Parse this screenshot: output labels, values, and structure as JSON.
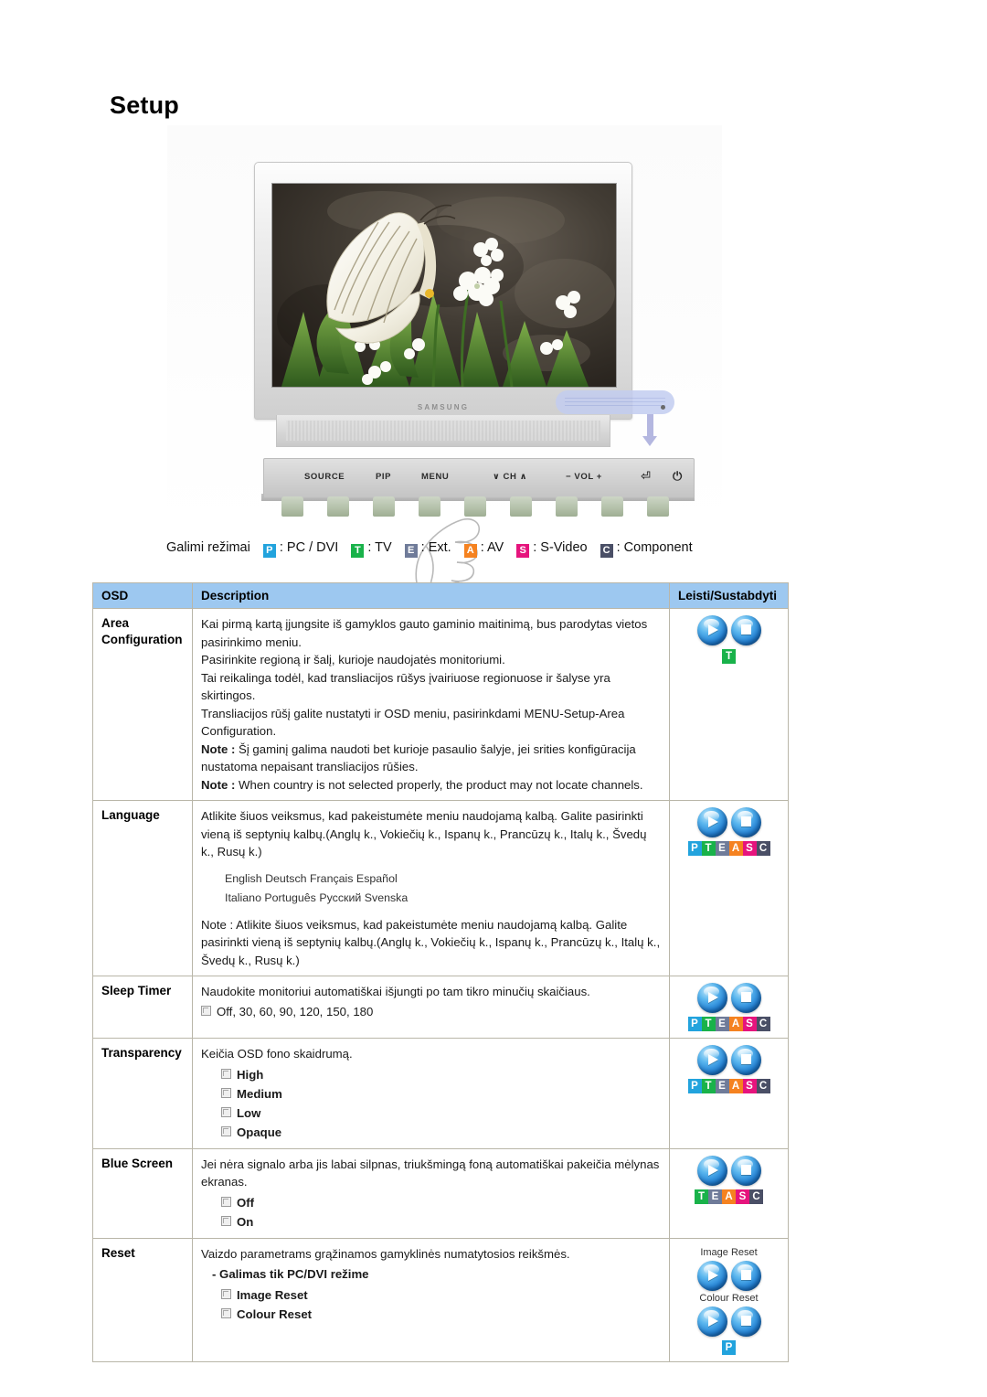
{
  "page": {
    "title": "Setup"
  },
  "illustration": {
    "brand": "SAMSUNG",
    "controls": [
      "SOURCE",
      "PIP",
      "MENU",
      "∨  CH  ∧",
      "−  VOL  +",
      "⏎",
      "⏻"
    ]
  },
  "modes": {
    "lead": "Galimi režimai",
    "items": [
      {
        "letter": "P",
        "label": ": PC / DVI",
        "color": "#22a3dd"
      },
      {
        "letter": "T",
        "label": ": TV",
        "color": "#19b24a"
      },
      {
        "letter": "E",
        "label": ": Ext.",
        "color": "#6f7b99"
      },
      {
        "letter": "A",
        "label": ": AV",
        "color": "#f58220"
      },
      {
        "letter": "S",
        "label": ": S-Video",
        "color": "#e6147d"
      },
      {
        "letter": "C",
        "label": ": Component",
        "color": "#4a4f66"
      }
    ]
  },
  "table": {
    "headers": [
      "OSD",
      "Description",
      "Leisti/Sustabdyti"
    ],
    "header_bg": "#9dc8f0",
    "rows": [
      {
        "osd": "Area Configuration",
        "paragraphs": [
          "Kai pirmą kartą įjungsite iš gamyklos gauto gaminio maitinimą, bus parodytas vietos pasirinkimo meniu.",
          "Pasirinkite regioną ir šalį, kurioje naudojatės monitoriumi.",
          "Tai reikalinga todėl, kad transliacijos rūšys įvairiuose regionuose ir šalyse yra skirtingos.",
          "Transliacijos rūšį galite nustatyti ir OSD meniu, pasirinkdami MENU-Setup-Area Configuration."
        ],
        "notes": [
          {
            "label": "Note :",
            "text": " Šį gaminį galima naudoti bet kurioje pasaulio šalyje, jei srities konfigūracija nustatoma nepaisant transliacijos rūšies."
          },
          {
            "label": "Note :",
            "text": " When country is not selected properly, the product may not locate channels."
          }
        ],
        "tags": [
          {
            "letter": "T",
            "color": "#19b24a"
          }
        ]
      },
      {
        "osd": "Language",
        "paragraphs": [
          "Atlikite šiuos veiksmus, kad pakeistumėte meniu naudojamą kalbą. Galite pasirinkti vieną iš septynių kalbų.(Anglų k., Vokiečių k., Ispanų k., Prancūzų k., Italų k., Švedų k., Rusų k.)"
        ],
        "languages": [
          "English  Deutsch  Français  Español",
          "Italiano  Português  Русский  Svenska"
        ],
        "notes": [
          {
            "label": "",
            "text": "Note : Atlikite šiuos veiksmus, kad pakeistumėte meniu naudojamą kalbą. Galite pasirinkti vieną iš septynių kalbų.(Anglų k., Vokiečių k., Ispanų k., Prancūzų k., Italų k., Švedų k., Rusų k.)"
          }
        ],
        "tags": [
          {
            "letter": "P",
            "color": "#22a3dd"
          },
          {
            "letter": "T",
            "color": "#19b24a"
          },
          {
            "letter": "E",
            "color": "#6f7b99"
          },
          {
            "letter": "A",
            "color": "#f58220"
          },
          {
            "letter": "S",
            "color": "#e6147d"
          },
          {
            "letter": "C",
            "color": "#4a4f66"
          }
        ]
      },
      {
        "osd": "Sleep Timer",
        "paragraphs": [
          "Naudokite monitoriui automatiškai išjungti po tam tikro minučių skaičiaus."
        ],
        "bullets": [
          "Off, 30, 60, 90, 120, 150, 180"
        ],
        "bullets_bold": false,
        "tags": [
          {
            "letter": "P",
            "color": "#22a3dd"
          },
          {
            "letter": "T",
            "color": "#19b24a"
          },
          {
            "letter": "E",
            "color": "#6f7b99"
          },
          {
            "letter": "A",
            "color": "#f58220"
          },
          {
            "letter": "S",
            "color": "#e6147d"
          },
          {
            "letter": "C",
            "color": "#4a4f66"
          }
        ]
      },
      {
        "osd": "Transparency",
        "paragraphs": [
          "Keičia OSD fono skaidrumą."
        ],
        "bullets": [
          "High",
          "Medium",
          "Low",
          "Opaque"
        ],
        "bullets_bold": true,
        "tags": [
          {
            "letter": "P",
            "color": "#22a3dd"
          },
          {
            "letter": "T",
            "color": "#19b24a"
          },
          {
            "letter": "E",
            "color": "#6f7b99"
          },
          {
            "letter": "A",
            "color": "#f58220"
          },
          {
            "letter": "S",
            "color": "#e6147d"
          },
          {
            "letter": "C",
            "color": "#4a4f66"
          }
        ]
      },
      {
        "osd": "Blue Screen",
        "paragraphs": [
          "Jei nėra signalo arba jis labai silpnas, triukšmingą foną automatiškai pakeičia mėlynas ekranas."
        ],
        "bullets": [
          "Off",
          "On"
        ],
        "bullets_bold": true,
        "tags": [
          {
            "letter": "T",
            "color": "#19b24a"
          },
          {
            "letter": "E",
            "color": "#6f7b99"
          },
          {
            "letter": "A",
            "color": "#f58220"
          },
          {
            "letter": "S",
            "color": "#e6147d"
          },
          {
            "letter": "C",
            "color": "#4a4f66"
          }
        ]
      },
      {
        "osd": "Reset",
        "paragraphs": [
          "Vaizdo parametrams grąžinamos gamyklinės numatytosios reikšmės."
        ],
        "dash_line": "- Galimas tik PC/DVI režime",
        "bullets": [
          "Image Reset",
          "Colour Reset"
        ],
        "bullets_bold": true,
        "ctl_labels": [
          "Image Reset",
          "Colour Reset"
        ],
        "tags": [
          {
            "letter": "P",
            "color": "#22a3dd"
          }
        ]
      }
    ]
  }
}
